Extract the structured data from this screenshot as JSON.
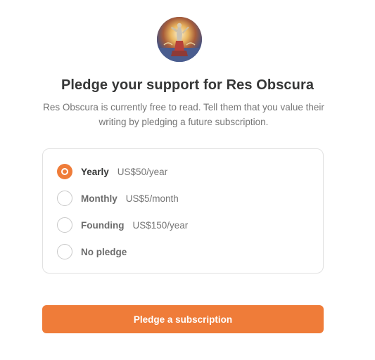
{
  "publication": {
    "name": "Res Obscura",
    "avatar_icon": "publication-avatar"
  },
  "header": {
    "title": "Pledge your support for Res Obscura",
    "subtitle": "Res Obscura is currently free to read. Tell them that you value their writing by pledging a future subscription."
  },
  "plans": [
    {
      "name": "Yearly",
      "price": "US$50/year",
      "selected": true
    },
    {
      "name": "Monthly",
      "price": "US$5/month",
      "selected": false
    },
    {
      "name": "Founding",
      "price": "US$150/year",
      "selected": false
    },
    {
      "name": "No pledge",
      "price": "",
      "selected": false
    }
  ],
  "cta": {
    "label": "Pledge a subscription"
  },
  "colors": {
    "accent": "#ef7c39",
    "title_text": "#363737",
    "muted_text": "#757575",
    "border": "#e1e1e1"
  }
}
